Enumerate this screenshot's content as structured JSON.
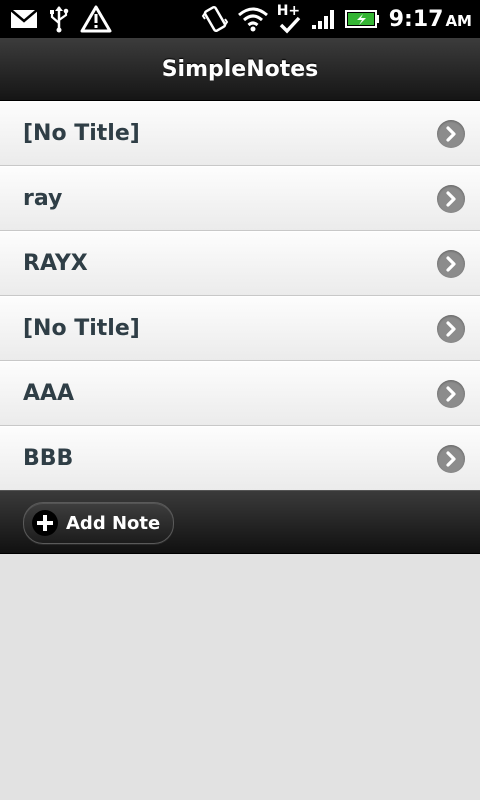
{
  "status_bar": {
    "time": "9:17",
    "ampm": "AM",
    "network_label": "H+",
    "icons": [
      "mail-icon",
      "usb-icon",
      "warning-icon",
      "vibrate-icon",
      "wifi-icon",
      "network-h-plus-icon",
      "signal-icon",
      "battery-charging-icon"
    ]
  },
  "header": {
    "title": "SimpleNotes"
  },
  "notes": [
    {
      "label": "[No Title]"
    },
    {
      "label": "ray"
    },
    {
      "label": "RAYX"
    },
    {
      "label": "[No Title]"
    },
    {
      "label": "AAA"
    },
    {
      "label": "BBB"
    }
  ],
  "footer": {
    "add_label": "Add Note"
  },
  "colors": {
    "accent_text": "#2f3e46",
    "chevron": "#8c8c8c",
    "bar_dark": "#151515",
    "background": "#e2e2e2"
  }
}
